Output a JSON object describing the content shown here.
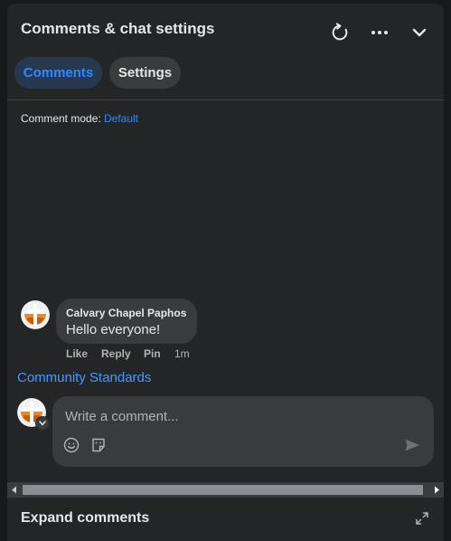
{
  "header": {
    "title": "Comments & chat settings",
    "icons": [
      "refresh-icon",
      "more-icon",
      "chevron-down-icon"
    ]
  },
  "tabs": [
    {
      "label": "Comments",
      "active": true
    },
    {
      "label": "Settings",
      "active": false
    }
  ],
  "comment_mode": {
    "label": "Comment mode:",
    "value": "Default"
  },
  "comments": [
    {
      "author": "Calvary Chapel Paphos",
      "text": "Hello everyone!",
      "actions": [
        "Like",
        "Reply",
        "Pin"
      ],
      "time": "1m"
    }
  ],
  "community_standards": "Community Standards",
  "composer": {
    "placeholder": "Write a comment...",
    "icons": [
      "emoji-icon",
      "sticker-icon",
      "send-icon"
    ]
  },
  "footer": {
    "label": "Expand comments",
    "icon": "expand-icon"
  },
  "colors": {
    "accent": "#2d88ff",
    "link": "#4599ff",
    "panel": "#242526",
    "surface": "#3a3b3c"
  }
}
